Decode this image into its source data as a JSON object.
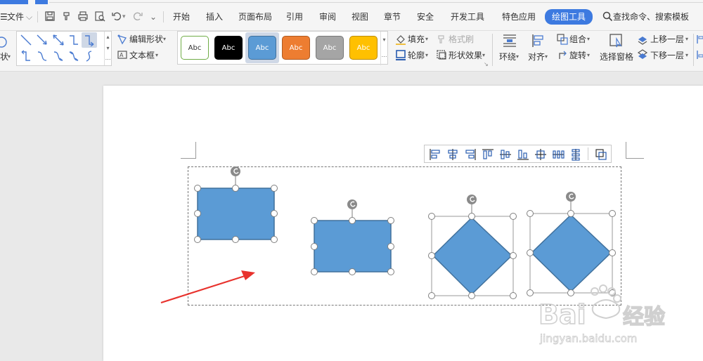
{
  "menubar": {
    "file_label": "文件",
    "tabs": [
      {
        "label": "开始"
      },
      {
        "label": "插入"
      },
      {
        "label": "页面布局"
      },
      {
        "label": "引用"
      },
      {
        "label": "审阅"
      },
      {
        "label": "视图"
      },
      {
        "label": "章节"
      },
      {
        "label": "安全"
      },
      {
        "label": "开发工具"
      },
      {
        "label": "特色应用"
      },
      {
        "label": "绘图工具"
      }
    ],
    "search_label": "查找命令、搜索模板",
    "accent": "#3d7ae0"
  },
  "ribbon": {
    "left_cut_label": "状",
    "edit_shape": "编辑形状",
    "text_box": "文本框",
    "style_presets": [
      {
        "label": "Abc",
        "bg": "#ffffff",
        "fg": "#333333",
        "border": "#70ad47"
      },
      {
        "label": "Abc",
        "bg": "#000000",
        "fg": "#ffffff",
        "border": "#000000"
      },
      {
        "label": "Abc",
        "bg": "#5b9bd5",
        "fg": "#ffffff",
        "border": "#41719c"
      },
      {
        "label": "Abc",
        "bg": "#ed7d31",
        "fg": "#ffffff",
        "border": "#ae5a21"
      },
      {
        "label": "Abc",
        "bg": "#a5a5a5",
        "fg": "#ffffff",
        "border": "#787878"
      },
      {
        "label": "Abc",
        "bg": "#ffc000",
        "fg": "#ffffff",
        "border": "#bc8c00"
      }
    ],
    "fill": "填充",
    "format_brush": "格式刷",
    "outline": "轮廓",
    "shape_effects": "形状效果",
    "wrap": "环绕",
    "align": "对齐",
    "group": "组合",
    "rotate": "旋转",
    "selection_pane": "选择窗格",
    "bring_forward": "上移一层",
    "send_backward": "下移一层"
  },
  "shapes": {
    "fill": "#5b9bd5",
    "stroke": "#41719c",
    "handle_fill": "#ffffff",
    "handle_stroke": "#7f7f7f"
  },
  "watermark": {
    "brand": "Bai",
    "brand_cn": "经验",
    "url": "jingyan.baidu.com"
  }
}
